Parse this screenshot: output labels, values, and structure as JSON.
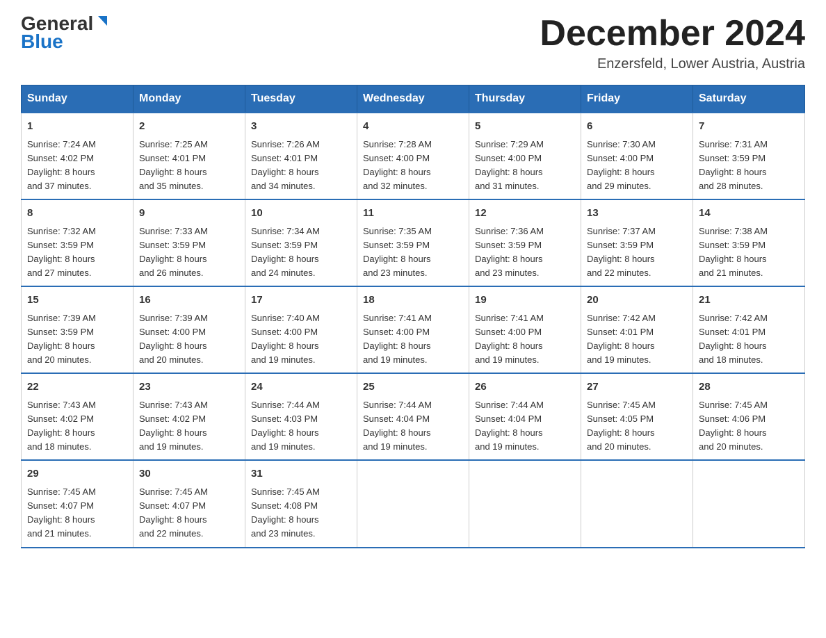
{
  "header": {
    "logo_general": "General",
    "logo_blue": "Blue",
    "month_title": "December 2024",
    "location": "Enzersfeld, Lower Austria, Austria"
  },
  "weekdays": [
    "Sunday",
    "Monday",
    "Tuesday",
    "Wednesday",
    "Thursday",
    "Friday",
    "Saturday"
  ],
  "weeks": [
    [
      {
        "day": "1",
        "sunrise": "Sunrise: 7:24 AM",
        "sunset": "Sunset: 4:02 PM",
        "daylight": "Daylight: 8 hours",
        "daylight2": "and 37 minutes."
      },
      {
        "day": "2",
        "sunrise": "Sunrise: 7:25 AM",
        "sunset": "Sunset: 4:01 PM",
        "daylight": "Daylight: 8 hours",
        "daylight2": "and 35 minutes."
      },
      {
        "day": "3",
        "sunrise": "Sunrise: 7:26 AM",
        "sunset": "Sunset: 4:01 PM",
        "daylight": "Daylight: 8 hours",
        "daylight2": "and 34 minutes."
      },
      {
        "day": "4",
        "sunrise": "Sunrise: 7:28 AM",
        "sunset": "Sunset: 4:00 PM",
        "daylight": "Daylight: 8 hours",
        "daylight2": "and 32 minutes."
      },
      {
        "day": "5",
        "sunrise": "Sunrise: 7:29 AM",
        "sunset": "Sunset: 4:00 PM",
        "daylight": "Daylight: 8 hours",
        "daylight2": "and 31 minutes."
      },
      {
        "day": "6",
        "sunrise": "Sunrise: 7:30 AM",
        "sunset": "Sunset: 4:00 PM",
        "daylight": "Daylight: 8 hours",
        "daylight2": "and 29 minutes."
      },
      {
        "day": "7",
        "sunrise": "Sunrise: 7:31 AM",
        "sunset": "Sunset: 3:59 PM",
        "daylight": "Daylight: 8 hours",
        "daylight2": "and 28 minutes."
      }
    ],
    [
      {
        "day": "8",
        "sunrise": "Sunrise: 7:32 AM",
        "sunset": "Sunset: 3:59 PM",
        "daylight": "Daylight: 8 hours",
        "daylight2": "and 27 minutes."
      },
      {
        "day": "9",
        "sunrise": "Sunrise: 7:33 AM",
        "sunset": "Sunset: 3:59 PM",
        "daylight": "Daylight: 8 hours",
        "daylight2": "and 26 minutes."
      },
      {
        "day": "10",
        "sunrise": "Sunrise: 7:34 AM",
        "sunset": "Sunset: 3:59 PM",
        "daylight": "Daylight: 8 hours",
        "daylight2": "and 24 minutes."
      },
      {
        "day": "11",
        "sunrise": "Sunrise: 7:35 AM",
        "sunset": "Sunset: 3:59 PM",
        "daylight": "Daylight: 8 hours",
        "daylight2": "and 23 minutes."
      },
      {
        "day": "12",
        "sunrise": "Sunrise: 7:36 AM",
        "sunset": "Sunset: 3:59 PM",
        "daylight": "Daylight: 8 hours",
        "daylight2": "and 23 minutes."
      },
      {
        "day": "13",
        "sunrise": "Sunrise: 7:37 AM",
        "sunset": "Sunset: 3:59 PM",
        "daylight": "Daylight: 8 hours",
        "daylight2": "and 22 minutes."
      },
      {
        "day": "14",
        "sunrise": "Sunrise: 7:38 AM",
        "sunset": "Sunset: 3:59 PM",
        "daylight": "Daylight: 8 hours",
        "daylight2": "and 21 minutes."
      }
    ],
    [
      {
        "day": "15",
        "sunrise": "Sunrise: 7:39 AM",
        "sunset": "Sunset: 3:59 PM",
        "daylight": "Daylight: 8 hours",
        "daylight2": "and 20 minutes."
      },
      {
        "day": "16",
        "sunrise": "Sunrise: 7:39 AM",
        "sunset": "Sunset: 4:00 PM",
        "daylight": "Daylight: 8 hours",
        "daylight2": "and 20 minutes."
      },
      {
        "day": "17",
        "sunrise": "Sunrise: 7:40 AM",
        "sunset": "Sunset: 4:00 PM",
        "daylight": "Daylight: 8 hours",
        "daylight2": "and 19 minutes."
      },
      {
        "day": "18",
        "sunrise": "Sunrise: 7:41 AM",
        "sunset": "Sunset: 4:00 PM",
        "daylight": "Daylight: 8 hours",
        "daylight2": "and 19 minutes."
      },
      {
        "day": "19",
        "sunrise": "Sunrise: 7:41 AM",
        "sunset": "Sunset: 4:00 PM",
        "daylight": "Daylight: 8 hours",
        "daylight2": "and 19 minutes."
      },
      {
        "day": "20",
        "sunrise": "Sunrise: 7:42 AM",
        "sunset": "Sunset: 4:01 PM",
        "daylight": "Daylight: 8 hours",
        "daylight2": "and 19 minutes."
      },
      {
        "day": "21",
        "sunrise": "Sunrise: 7:42 AM",
        "sunset": "Sunset: 4:01 PM",
        "daylight": "Daylight: 8 hours",
        "daylight2": "and 18 minutes."
      }
    ],
    [
      {
        "day": "22",
        "sunrise": "Sunrise: 7:43 AM",
        "sunset": "Sunset: 4:02 PM",
        "daylight": "Daylight: 8 hours",
        "daylight2": "and 18 minutes."
      },
      {
        "day": "23",
        "sunrise": "Sunrise: 7:43 AM",
        "sunset": "Sunset: 4:02 PM",
        "daylight": "Daylight: 8 hours",
        "daylight2": "and 19 minutes."
      },
      {
        "day": "24",
        "sunrise": "Sunrise: 7:44 AM",
        "sunset": "Sunset: 4:03 PM",
        "daylight": "Daylight: 8 hours",
        "daylight2": "and 19 minutes."
      },
      {
        "day": "25",
        "sunrise": "Sunrise: 7:44 AM",
        "sunset": "Sunset: 4:04 PM",
        "daylight": "Daylight: 8 hours",
        "daylight2": "and 19 minutes."
      },
      {
        "day": "26",
        "sunrise": "Sunrise: 7:44 AM",
        "sunset": "Sunset: 4:04 PM",
        "daylight": "Daylight: 8 hours",
        "daylight2": "and 19 minutes."
      },
      {
        "day": "27",
        "sunrise": "Sunrise: 7:45 AM",
        "sunset": "Sunset: 4:05 PM",
        "daylight": "Daylight: 8 hours",
        "daylight2": "and 20 minutes."
      },
      {
        "day": "28",
        "sunrise": "Sunrise: 7:45 AM",
        "sunset": "Sunset: 4:06 PM",
        "daylight": "Daylight: 8 hours",
        "daylight2": "and 20 minutes."
      }
    ],
    [
      {
        "day": "29",
        "sunrise": "Sunrise: 7:45 AM",
        "sunset": "Sunset: 4:07 PM",
        "daylight": "Daylight: 8 hours",
        "daylight2": "and 21 minutes."
      },
      {
        "day": "30",
        "sunrise": "Sunrise: 7:45 AM",
        "sunset": "Sunset: 4:07 PM",
        "daylight": "Daylight: 8 hours",
        "daylight2": "and 22 minutes."
      },
      {
        "day": "31",
        "sunrise": "Sunrise: 7:45 AM",
        "sunset": "Sunset: 4:08 PM",
        "daylight": "Daylight: 8 hours",
        "daylight2": "and 23 minutes."
      },
      null,
      null,
      null,
      null
    ]
  ]
}
